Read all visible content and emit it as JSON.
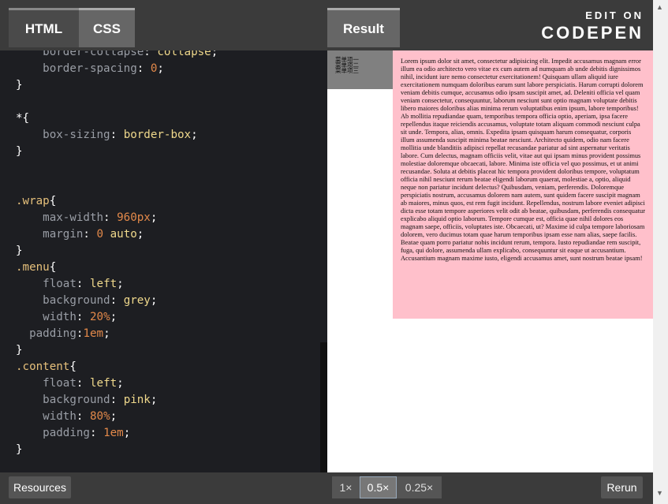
{
  "tabs": {
    "html": "HTML",
    "css": "CSS",
    "result": "Result"
  },
  "brand": {
    "edit_on": "EDIT ON",
    "logo": "CODEPEN"
  },
  "code_lines": [
    [
      {
        "t": "    ",
        "c": "br"
      },
      {
        "t": "border-collapse",
        "c": "prop"
      },
      {
        "t": ": ",
        "c": "br"
      },
      {
        "t": "collapse",
        "c": "val-kw"
      },
      {
        "t": ";",
        "c": "br"
      }
    ],
    [
      {
        "t": "    ",
        "c": "br"
      },
      {
        "t": "border-spacing",
        "c": "prop"
      },
      {
        "t": ": ",
        "c": "br"
      },
      {
        "t": "0",
        "c": "val-num"
      },
      {
        "t": ";",
        "c": "br"
      }
    ],
    [
      {
        "t": "}",
        "c": "br"
      }
    ],
    [
      {
        "t": "",
        "c": "br"
      }
    ],
    [
      {
        "t": "*{",
        "c": "br"
      }
    ],
    [
      {
        "t": "    ",
        "c": "br"
      },
      {
        "t": "box-sizing",
        "c": "prop"
      },
      {
        "t": ": ",
        "c": "br"
      },
      {
        "t": "border-box",
        "c": "val-kw"
      },
      {
        "t": ";",
        "c": "br"
      }
    ],
    [
      {
        "t": "}",
        "c": "br"
      }
    ],
    [
      {
        "t": "",
        "c": "br"
      }
    ],
    [
      {
        "t": "",
        "c": "br"
      }
    ],
    [
      {
        "t": ".wrap",
        "c": "sel"
      },
      {
        "t": "{",
        "c": "br"
      }
    ],
    [
      {
        "t": "    ",
        "c": "br"
      },
      {
        "t": "max-width",
        "c": "prop"
      },
      {
        "t": ": ",
        "c": "br"
      },
      {
        "t": "960px",
        "c": "val-num"
      },
      {
        "t": ";",
        "c": "br"
      }
    ],
    [
      {
        "t": "    ",
        "c": "br"
      },
      {
        "t": "margin",
        "c": "prop"
      },
      {
        "t": ": ",
        "c": "br"
      },
      {
        "t": "0",
        "c": "val-num"
      },
      {
        "t": " ",
        "c": "br"
      },
      {
        "t": "auto",
        "c": "val-kw"
      },
      {
        "t": ";",
        "c": "br"
      }
    ],
    [
      {
        "t": "}",
        "c": "br"
      }
    ],
    [
      {
        "t": ".menu",
        "c": "sel"
      },
      {
        "t": "{",
        "c": "br"
      }
    ],
    [
      {
        "t": "    ",
        "c": "br"
      },
      {
        "t": "float",
        "c": "prop"
      },
      {
        "t": ": ",
        "c": "br"
      },
      {
        "t": "left",
        "c": "val-kw"
      },
      {
        "t": ";",
        "c": "br"
      }
    ],
    [
      {
        "t": "    ",
        "c": "br"
      },
      {
        "t": "background",
        "c": "prop"
      },
      {
        "t": ": ",
        "c": "br"
      },
      {
        "t": "grey",
        "c": "val-kw"
      },
      {
        "t": ";",
        "c": "br"
      }
    ],
    [
      {
        "t": "    ",
        "c": "br"
      },
      {
        "t": "width",
        "c": "prop"
      },
      {
        "t": ": ",
        "c": "br"
      },
      {
        "t": "20%",
        "c": "val-num"
      },
      {
        "t": ";",
        "c": "br"
      }
    ],
    [
      {
        "t": "  ",
        "c": "br"
      },
      {
        "t": "padding",
        "c": "prop"
      },
      {
        "t": ":",
        "c": "br"
      },
      {
        "t": "1em",
        "c": "val-num"
      },
      {
        "t": ";",
        "c": "br"
      }
    ],
    [
      {
        "t": "}",
        "c": "br"
      }
    ],
    [
      {
        "t": ".content",
        "c": "sel"
      },
      {
        "t": "{",
        "c": "br"
      }
    ],
    [
      {
        "t": "    ",
        "c": "br"
      },
      {
        "t": "float",
        "c": "prop"
      },
      {
        "t": ": ",
        "c": "br"
      },
      {
        "t": "left",
        "c": "val-kw"
      },
      {
        "t": ";",
        "c": "br"
      }
    ],
    [
      {
        "t": "    ",
        "c": "br"
      },
      {
        "t": "background",
        "c": "prop"
      },
      {
        "t": ": ",
        "c": "br"
      },
      {
        "t": "pink",
        "c": "val-kw"
      },
      {
        "t": ";",
        "c": "br"
      }
    ],
    [
      {
        "t": "    ",
        "c": "br"
      },
      {
        "t": "width",
        "c": "prop"
      },
      {
        "t": ": ",
        "c": "br"
      },
      {
        "t": "80%",
        "c": "val-num"
      },
      {
        "t": ";",
        "c": "br"
      }
    ],
    [
      {
        "t": "    ",
        "c": "br"
      },
      {
        "t": "padding",
        "c": "prop"
      },
      {
        "t": ": ",
        "c": "br"
      },
      {
        "t": "1em",
        "c": "val-num"
      },
      {
        "t": ";",
        "c": "br"
      }
    ],
    [
      {
        "t": "}",
        "c": "br"
      }
    ]
  ],
  "result": {
    "menu_items": [
      "菜单项一",
      "菜单项二",
      "菜单项三"
    ],
    "content_text": "Lorem ipsum dolor sit amet, consectetur adipisicing elit. Impedit accusamus magnam error illum ea odio architecto vero vitae ex cum autem ad numquam ab unde debitis dignissimos nihil, incidunt iure nemo consectetur exercitationem! Quisquam ullam aliquid iure exercitationem numquam doloribus earum sunt labore perspiciatis. Harum corrupti dolorem veniam debitis cumque, accusamus odio ipsam suscipit amet, ad. Deleniti officia vel quam veniam consectetur, consequuntur, laborum nesciunt sunt optio magnam voluptate debitis libero maiores doloribus alias minima rerum voluptatibus enim ipsum, labore temporibus! Ab mollitia repudiandae quam, temporibus tempora officia optio, aperiam, ipsa facere repellendus itaque reiciendis accusamus, voluptate totam aliquam commodi nesciunt culpa sit unde. Tempora, alias, omnis. Expedita ipsam quisquam harum consequatur, corporis illum assumenda suscipit minima beatae nesciunt. Architecto quidem, odio nam facere mollitia unde blanditiis adipisci repellat recusandae pariatur ad sint aspernatur veritatis labore. Cum delectus, magnam officiis velit, vitae aut qui ipsam minus provident possimus molestiae doloremque obcaecati, labore. Minima iste officia vel quo possimus, et ut animi recusandae. Soluta at debitis placeat hic tempora provident doloribus tempore, voluptatum officia nihil nesciunt rerum beatae eligendi laborum quaerat, molestiae a, optio, aliquid neque non pariatur incidunt delectus? Quibusdam, veniam, perferendis. Doloremque perspiciatis nostrum, accusamus dolorem nam autem, sunt quidem facere suscipit magnam ab maiores, minus quos, est rem fugit incidunt. Repellendus, nostrum labore eveniet adipisci dicta esse totam tempore asperiores velit odit ab beatae, quibusdam, perferendis consequatur explicabo aliquid optio laborum. Tempore cumque est, officia quae nihil dolores eos magnam saepe, officiis, voluptates iste. Obcaecati, ut? Maxime id culpa tempore laboriosam dolorem, vero ducimus totam quae harum temporibus ipsam esse nam alias, saepe facilis. Beatae quam porro pariatur nobis incidunt rerum, tempora. Iusto repudiandae rem suscipit, fuga, qui dolore, assumenda ullam explicabo, consequuntur sit eaque ut accusantium. Accusantium magnam maxime iusto, eligendi accusamus amet, sunt nostrum beatae ipsam!"
  },
  "bottom": {
    "resources": "Resources",
    "zoom_1": "1×",
    "zoom_05": "0.5×",
    "zoom_025": "0.25×",
    "rerun": "Rerun"
  }
}
